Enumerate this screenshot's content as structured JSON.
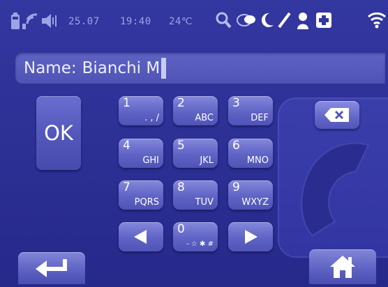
{
  "status_bar": {
    "date": "25.07",
    "time": "19:40",
    "temperature": "24℃",
    "icons": [
      "battery-icon",
      "signal-icon",
      "speaker-icon",
      "search-icon",
      "chat-icon",
      "moon-icon",
      "pen-icon",
      "person-icon",
      "medical-cross-icon",
      "wifi-icon"
    ]
  },
  "name_field": {
    "label": "Name:",
    "value": "Bianchi M"
  },
  "keys": {
    "ok": "OK",
    "k1": {
      "num": "1",
      "sub": ". , / "
    },
    "k2": {
      "num": "2",
      "sub": "ABC"
    },
    "k3": {
      "num": "3",
      "sub": "DEF"
    },
    "k4": {
      "num": "4",
      "sub": "GHI"
    },
    "k5": {
      "num": "5",
      "sub": "JKL"
    },
    "k6": {
      "num": "6",
      "sub": "MNO"
    },
    "k7": {
      "num": "7",
      "sub": "PQRS"
    },
    "k8": {
      "num": "8",
      "sub": "TUV"
    },
    "k9": {
      "num": "9",
      "sub": "WXYZ"
    },
    "k0": {
      "num": "0",
      "sub": "- ☆ ✱ #"
    }
  },
  "colors": {
    "background": "#2c2f93",
    "key": "#6266c6",
    "field": "#5458bb",
    "text": "#ffffff"
  }
}
